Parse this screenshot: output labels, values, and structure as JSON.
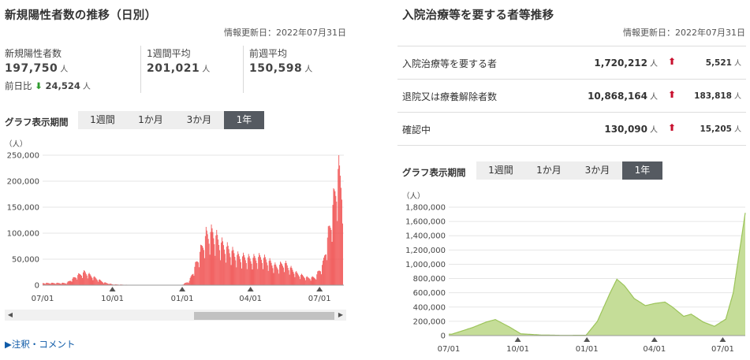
{
  "left": {
    "title": "新規陽性者数の推移（日別）",
    "updated": "情報更新日：2022年07月31日",
    "stats": {
      "new_label": "新規陽性者数",
      "new_value": "197,750",
      "unit": "人",
      "diff_label": "前日比",
      "diff_arrow": "⬇",
      "diff_value": "24,524",
      "week_avg_label": "1週間平均",
      "week_avg_value": "201,021",
      "prev_week_label": "前週平均",
      "prev_week_value": "150,598"
    },
    "period_label": "グラフ表示期間",
    "periods": [
      "1週間",
      "1か月",
      "3か月",
      "1年"
    ],
    "active_period": "1年",
    "notes_link": "▶注釈・コメント"
  },
  "right": {
    "title": "入院治療等を要する者等推移",
    "updated": "情報更新日：2022年07月31日",
    "rows": [
      {
        "label": "入院治療等を要する者",
        "value": "1,720,212",
        "unit": "人",
        "arrow": "⬆",
        "diff": "5,521",
        "diff_unit": "人"
      },
      {
        "label": "退院又は療養解除者数",
        "value": "10,868,164",
        "unit": "人",
        "arrow": "⬆",
        "diff": "183,818",
        "diff_unit": "人"
      },
      {
        "label": "確認中",
        "value": "130,090",
        "unit": "人",
        "arrow": "⬆",
        "diff": "15,205",
        "diff_unit": "人"
      }
    ],
    "period_label": "グラフ表示期間",
    "periods": [
      "1週間",
      "1か月",
      "3か月",
      "1年"
    ],
    "active_period": "1年"
  },
  "colors": {
    "bar": "#f05050",
    "area_fill": "#c5dd98",
    "area_line": "#9cc45a",
    "down_arrow": "#2e9b2e",
    "up_arrow": "#c8102e"
  },
  "chart_data": [
    {
      "type": "bar",
      "ylabel": "（人）",
      "ylim": [
        0,
        250000
      ],
      "yticks": [
        0,
        50000,
        100000,
        150000,
        200000,
        250000
      ],
      "ytick_labels": [
        "0",
        "50,000",
        "100,000",
        "150,000",
        "200,000",
        "250,000"
      ],
      "xtick_labels": [
        "07/01",
        "10/01",
        "01/01",
        "04/01",
        "07/01"
      ],
      "grid": true,
      "x": [
        "2021-08-01",
        "2021-08-15",
        "2021-08-25",
        "2021-09-05",
        "2021-09-20",
        "2021-10-01",
        "2021-11-01",
        "2021-12-01",
        "2021-12-31",
        "2022-01-10",
        "2022-01-20",
        "2022-02-01",
        "2022-02-10",
        "2022-02-20",
        "2022-03-01",
        "2022-03-15",
        "2022-04-01",
        "2022-04-15",
        "2022-04-25",
        "2022-05-05",
        "2022-05-15",
        "2022-06-01",
        "2022-06-15",
        "2022-06-25",
        "2022-07-05",
        "2022-07-15",
        "2022-07-25",
        "2022-07-31"
      ],
      "values": [
        4000,
        18000,
        25000,
        16000,
        5000,
        1500,
        200,
        150,
        500,
        8000,
        45000,
        95000,
        100000,
        80000,
        70000,
        55000,
        50000,
        53000,
        45000,
        35000,
        42000,
        22000,
        14000,
        15000,
        40000,
        120000,
        215000,
        197750
      ]
    },
    {
      "type": "area",
      "ylabel": "（人）",
      "ylim": [
        0,
        1800000
      ],
      "yticks": [
        0,
        200000,
        400000,
        600000,
        800000,
        1000000,
        1200000,
        1400000,
        1600000,
        1800000
      ],
      "ytick_labels": [
        "0",
        "200,000",
        "400,000",
        "600,000",
        "800,000",
        "1,000,000",
        "1,200,000",
        "1,400,000",
        "1,600,000",
        "1,800,000"
      ],
      "xtick_labels": [
        "07/01",
        "10/01",
        "01/01",
        "04/01",
        "07/01"
      ],
      "grid": true,
      "x": [
        "2021-07-05",
        "2021-08-01",
        "2021-08-20",
        "2021-09-01",
        "2021-09-20",
        "2021-10-05",
        "2021-11-01",
        "2021-12-01",
        "2021-12-31",
        "2022-01-15",
        "2022-02-01",
        "2022-02-10",
        "2022-02-20",
        "2022-03-05",
        "2022-03-20",
        "2022-04-01",
        "2022-04-15",
        "2022-04-25",
        "2022-05-10",
        "2022-05-20",
        "2022-06-05",
        "2022-06-20",
        "2022-07-05",
        "2022-07-15",
        "2022-07-25",
        "2022-07-31"
      ],
      "values": [
        20000,
        110000,
        190000,
        225000,
        120000,
        25000,
        8000,
        3000,
        5000,
        200000,
        600000,
        790000,
        700000,
        520000,
        420000,
        450000,
        470000,
        400000,
        270000,
        300000,
        190000,
        130000,
        230000,
        600000,
        1300000,
        1720212
      ]
    }
  ]
}
